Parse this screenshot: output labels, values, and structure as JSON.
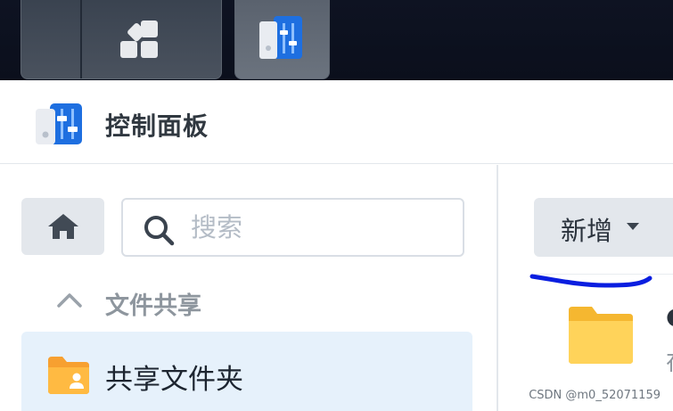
{
  "taskbar": {
    "main_icon": "grid-icon",
    "active_app_icon": "control-panel-icon"
  },
  "header": {
    "title": "控制面板",
    "icon": "control-panel-icon"
  },
  "sidebar": {
    "home_icon": "home-icon",
    "search": {
      "placeholder": "搜索",
      "value": ""
    },
    "group": {
      "label": "文件共享",
      "expanded": true
    },
    "items": [
      {
        "label": "共享文件夹",
        "icon": "shared-folder-icon",
        "selected": true
      }
    ]
  },
  "main": {
    "new_button": {
      "label": "新增",
      "icon": "caret-down-icon"
    },
    "row": {
      "icon": "folder-icon"
    }
  },
  "watermark": "CSDN @m0_52071159",
  "colors": {
    "taskbar_bg": "#0e1322",
    "selected_bg": "#e6f1fb",
    "button_bg": "#e3e7ec",
    "annotation_blue": "#0a1ee0",
    "folder_yellow": "#ffcf4a"
  }
}
